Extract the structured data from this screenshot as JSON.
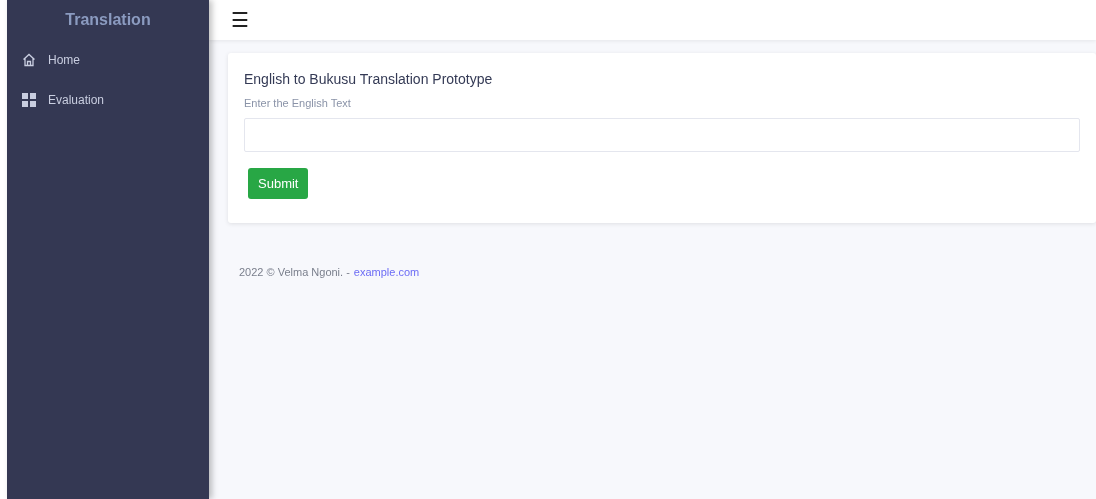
{
  "sidebar": {
    "title": "Translation",
    "items": [
      {
        "label": "Home",
        "kind": "home"
      },
      {
        "label": "Evaluation",
        "kind": "grid"
      }
    ]
  },
  "topbar": {
    "menu_icon": "☰"
  },
  "card": {
    "title": "English to Bukusu Translation Prototype",
    "field_label": "Enter the English Text",
    "button": "Submit"
  },
  "footer": {
    "text": "2022 © Velma Ngoni. -",
    "link": "example.com"
  }
}
